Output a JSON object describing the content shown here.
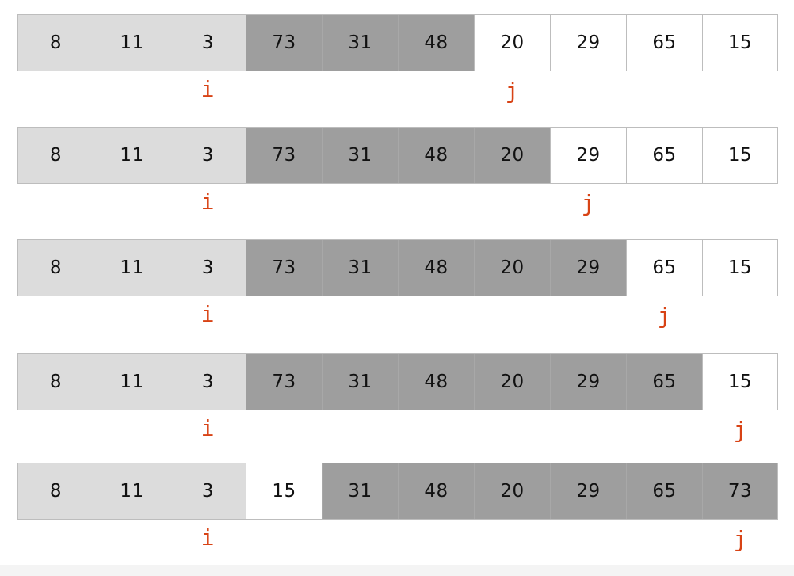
{
  "steps": [
    {
      "values": [
        "8",
        "11",
        "3",
        "73",
        "31",
        "48",
        "20",
        "29",
        "65",
        "15"
      ],
      "shades": [
        "light",
        "light",
        "light",
        "dark",
        "dark",
        "dark",
        "white",
        "white",
        "white",
        "white"
      ],
      "i_index": 2,
      "j_index": 6
    },
    {
      "values": [
        "8",
        "11",
        "3",
        "73",
        "31",
        "48",
        "20",
        "29",
        "65",
        "15"
      ],
      "shades": [
        "light",
        "light",
        "light",
        "dark",
        "dark",
        "dark",
        "dark",
        "white",
        "white",
        "white"
      ],
      "i_index": 2,
      "j_index": 7
    },
    {
      "values": [
        "8",
        "11",
        "3",
        "73",
        "31",
        "48",
        "20",
        "29",
        "65",
        "15"
      ],
      "shades": [
        "light",
        "light",
        "light",
        "dark",
        "dark",
        "dark",
        "dark",
        "dark",
        "white",
        "white"
      ],
      "i_index": 2,
      "j_index": 8
    },
    {
      "values": [
        "8",
        "11",
        "3",
        "73",
        "31",
        "48",
        "20",
        "29",
        "65",
        "15"
      ],
      "shades": [
        "light",
        "light",
        "light",
        "dark",
        "dark",
        "dark",
        "dark",
        "dark",
        "dark",
        "white"
      ],
      "i_index": 2,
      "j_index": 9
    },
    {
      "values": [
        "8",
        "11",
        "3",
        "15",
        "31",
        "48",
        "20",
        "29",
        "65",
        "73"
      ],
      "shades": [
        "light",
        "light",
        "light",
        "white",
        "dark",
        "dark",
        "dark",
        "dark",
        "dark",
        "dark"
      ],
      "i_index": 2,
      "j_index": 9
    }
  ],
  "pointer_labels": {
    "i": "i",
    "j": "j"
  },
  "colors": {
    "light_cell": "#dcdcdc",
    "dark_cell": "#9e9e9e",
    "white_cell": "#ffffff",
    "pointer": "#d84315"
  }
}
